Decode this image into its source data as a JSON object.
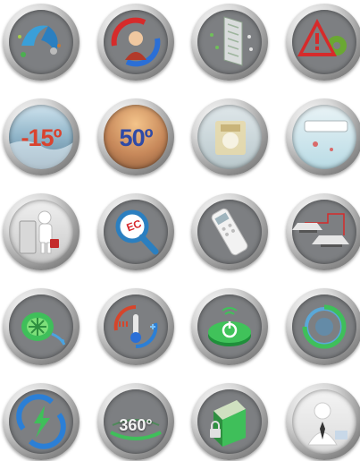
{
  "badges": [
    {
      "name": "air-purification-icon"
    },
    {
      "name": "swing-airflow-icon"
    },
    {
      "name": "filter-panel-icon"
    },
    {
      "name": "warning-gear-icon"
    },
    {
      "name": "low-temperature-icon",
      "text": "-15º",
      "color": "#d9432f"
    },
    {
      "name": "high-temperature-icon",
      "text": "50º",
      "color": "#2f4aa6"
    },
    {
      "name": "indoor-unit-display-icon"
    },
    {
      "name": "wall-unit-icon"
    },
    {
      "name": "service-engineer-icon"
    },
    {
      "name": "error-code-search-icon",
      "text": "EC"
    },
    {
      "name": "remote-control-icon"
    },
    {
      "name": "cassette-units-icon"
    },
    {
      "name": "fan-wash-icon"
    },
    {
      "name": "temperature-cycle-icon"
    },
    {
      "name": "power-button-icon"
    },
    {
      "name": "rotation-disc-icon"
    },
    {
      "name": "energy-cycle-icon"
    },
    {
      "name": "rotation-360-icon",
      "text": "360°"
    },
    {
      "name": "secure-lock-icon"
    },
    {
      "name": "business-person-icon"
    }
  ]
}
